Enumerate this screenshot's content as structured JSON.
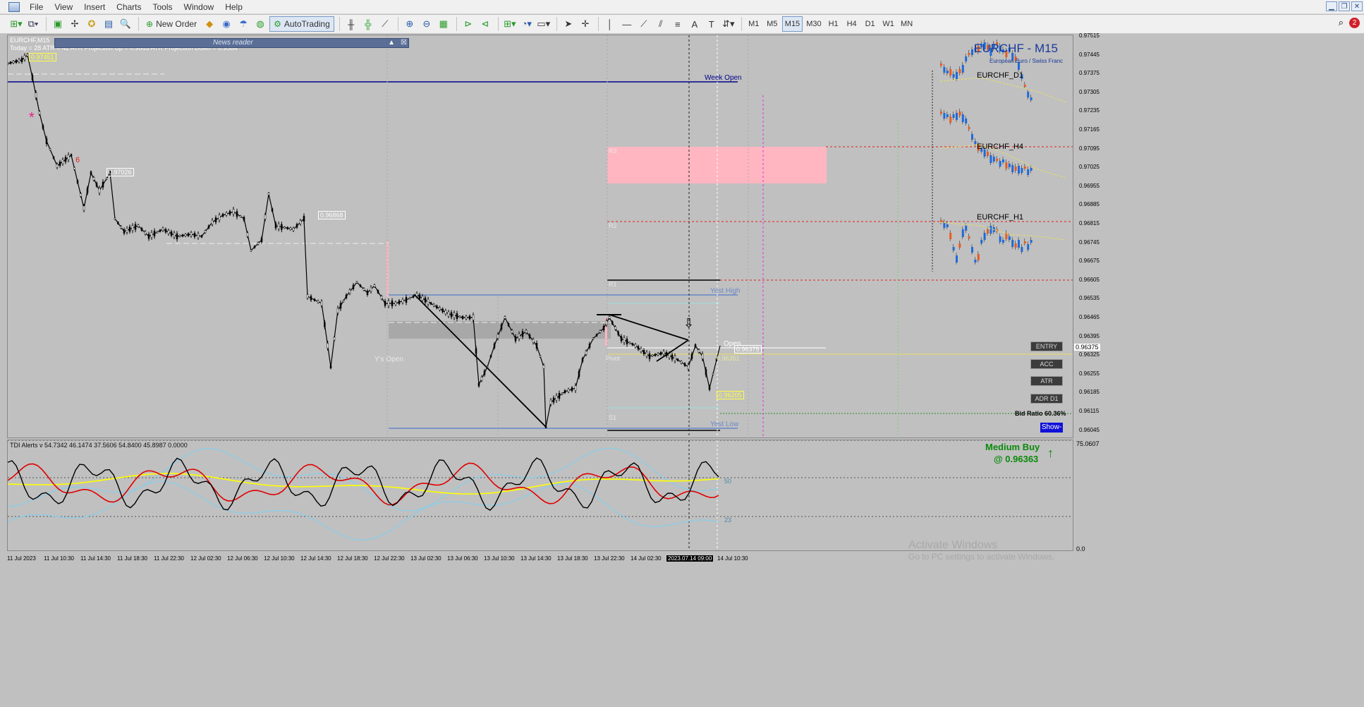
{
  "menu": [
    "File",
    "View",
    "Insert",
    "Charts",
    "Tools",
    "Window",
    "Help"
  ],
  "toolbar": {
    "new_order": "New Order",
    "autotrading": "AutoTrading",
    "timeframes": [
      "M1",
      "M5",
      "M15",
      "M30",
      "H1",
      "H4",
      "D1",
      "W1",
      "MN"
    ],
    "active_timeframe": "M15",
    "notification_count": "2"
  },
  "chart": {
    "window_title": "EURCHF,M15",
    "info_line": "Today = 28    ATR = 42    ATR Projection Up = 0.9663    ATR Projection Down = 0.9584",
    "news_reader": "News reader",
    "symbol_title": "EURCHF - M15",
    "symbol_subtitle": "European Euro / Swiss Franc",
    "mini_charts": [
      "EURCHF_D1",
      "EURCHF_H4",
      "EURCHF_H1"
    ],
    "levels": {
      "week_open": "Week Open",
      "yest_high": "Yest High",
      "yest_low": "Yest Low",
      "ys_open": "Y's Open",
      "pivot": "Pivot",
      "r1": "R1",
      "r2": "R2",
      "r3": "R3",
      "s1": "S1",
      "open": "Open"
    },
    "price_labels": [
      "0.97451",
      "0.97026",
      "0.96868",
      "0.96375",
      "0.96351",
      "0.96205"
    ],
    "buttons": [
      "ENTRY",
      "ACC",
      "ATR",
      "ADR D1"
    ],
    "bid_ratio": "Bid Ratio 60.36%",
    "show_button": "Show-",
    "signal": {
      "text": "Medium Buy",
      "price": "@ 0.96363",
      "color": "#0a8a0a"
    },
    "price_axis": [
      "0.97515",
      "0.97445",
      "0.97375",
      "0.97305",
      "0.97235",
      "0.97165",
      "0.97095",
      "0.97025",
      "0.96955",
      "0.96885",
      "0.96815",
      "0.96745",
      "0.96675",
      "0.96605",
      "0.96535",
      "0.96465",
      "0.96395",
      "0.96325",
      "0.96255",
      "0.96185",
      "0.96115",
      "0.96045"
    ],
    "current_price": "0.96375",
    "time_axis": [
      "11 Jul 2023",
      "11 Jul 10:30",
      "11 Jul 14:30",
      "11 Jul 18:30",
      "11 Jul 22:30",
      "12 Jul 02:30",
      "12 Jul 06:30",
      "12 Jul 10:30",
      "12 Jul 14:30",
      "12 Jul 18:30",
      "12 Jul 22:30",
      "13 Jul 02:30",
      "13 Jul 06:30",
      "13 Jul 10:30",
      "13 Jul 14:30",
      "13 Jul 18:30",
      "13 Jul 22:30",
      "14 Jul 02:30",
      "2023.07.14 09:00",
      "14 Jul 10:30"
    ]
  },
  "indicator": {
    "title": "TDI Alerts v 54.7342 46.1474 37.5606 54.8400 45.8987 0.0000",
    "levels": [
      "75",
      "50",
      "23"
    ],
    "axis_top": "75.0607",
    "axis_bottom": "0.0"
  },
  "watermark": {
    "line1": "Activate Windows",
    "line2": "Go to PC settings to activate Windows."
  },
  "colors": {
    "bull": "#1e6ad8",
    "bear": "#e85a1e",
    "pink_zone": "#ffb6c1",
    "level_red": "#e02020",
    "week_open": "#00008b"
  }
}
